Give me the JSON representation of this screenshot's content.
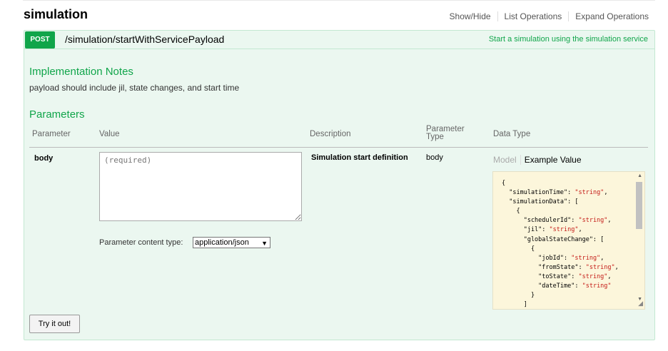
{
  "resource": {
    "title": "simulation",
    "links": [
      "Show/Hide",
      "List Operations",
      "Expand Operations"
    ]
  },
  "operation": {
    "method": "POST",
    "path": "/simulation/startWithServicePayload",
    "summary": "Start a simulation using the simulation service",
    "implementation_notes_heading": "Implementation Notes",
    "implementation_notes": "payload should include jil, state changes, and start time",
    "parameters_heading": "Parameters",
    "columns": {
      "parameter": "Parameter",
      "value": "Value",
      "description": "Description",
      "parameter_type": "Parameter Type",
      "data_type": "Data Type"
    },
    "param": {
      "name": "body",
      "placeholder": "(required)",
      "description": "Simulation start definition",
      "type": "body"
    },
    "content_type_label": "Parameter content type:",
    "content_type_value": "application/json",
    "model_tabs": {
      "model": "Model",
      "example": "Example Value"
    },
    "try_button": "Try it out!"
  },
  "colors": {
    "post_green": "#10a54a",
    "op_background": "#ebf7f0",
    "example_background": "#fcf6db"
  },
  "icons": [
    "chevron-down-icon",
    "scroll-up-arrow-icon",
    "scroll-down-arrow-icon",
    "resize-grip-icon"
  ]
}
